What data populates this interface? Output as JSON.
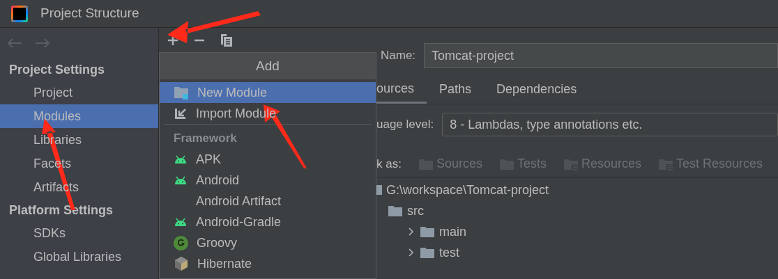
{
  "window": {
    "title": "Project Structure"
  },
  "sidebar": {
    "sections": [
      {
        "title": "Project Settings",
        "items": [
          {
            "label": "Project",
            "selected": false
          },
          {
            "label": "Modules",
            "selected": true
          },
          {
            "label": "Libraries",
            "selected": false
          },
          {
            "label": "Facets",
            "selected": false
          },
          {
            "label": "Artifacts",
            "selected": false
          }
        ]
      },
      {
        "title": "Platform Settings",
        "items": [
          {
            "label": "SDKs",
            "selected": false
          },
          {
            "label": "Global Libraries",
            "selected": false
          }
        ]
      }
    ]
  },
  "add_menu": {
    "title": "Add",
    "items": [
      {
        "kind": "module",
        "label": "New Module",
        "selected": true
      },
      {
        "kind": "import",
        "label": "Import Module",
        "selected": false
      },
      {
        "kind": "separator"
      },
      {
        "kind": "header",
        "label": "Framework"
      },
      {
        "kind": "android",
        "label": "APK",
        "selected": false
      },
      {
        "kind": "android",
        "label": "Android",
        "selected": false
      },
      {
        "kind": "plain",
        "label": "Android Artifact",
        "selected": false
      },
      {
        "kind": "android",
        "label": "Android-Gradle",
        "selected": false
      },
      {
        "kind": "groovy",
        "label": "Groovy",
        "selected": false
      },
      {
        "kind": "hibernate",
        "label": "Hibernate",
        "selected": false
      }
    ]
  },
  "module": {
    "name_label": "Name:",
    "name_value": "Tomcat-project",
    "tabs": [
      {
        "label": "ources",
        "selected": true
      },
      {
        "label": "Paths",
        "selected": false
      },
      {
        "label": "Dependencies",
        "selected": false
      }
    ],
    "language_label": "uage level:",
    "language_value": "8 - Lambdas, type annotations etc.",
    "mark_as_label": "k as:",
    "mark_as": [
      {
        "kind": "sources",
        "label": "Sources"
      },
      {
        "kind": "tests",
        "label": "Tests"
      },
      {
        "kind": "resources",
        "label": "Resources"
      },
      {
        "kind": "test_resources",
        "label": "Test Resources"
      }
    ],
    "tree": [
      {
        "label": "G:\\workspace\\Tomcat-project",
        "children": [
          {
            "label": "src",
            "children": [
              {
                "label": "main",
                "expanded": false
              },
              {
                "label": "test",
                "expanded": false
              }
            ]
          }
        ]
      }
    ]
  }
}
